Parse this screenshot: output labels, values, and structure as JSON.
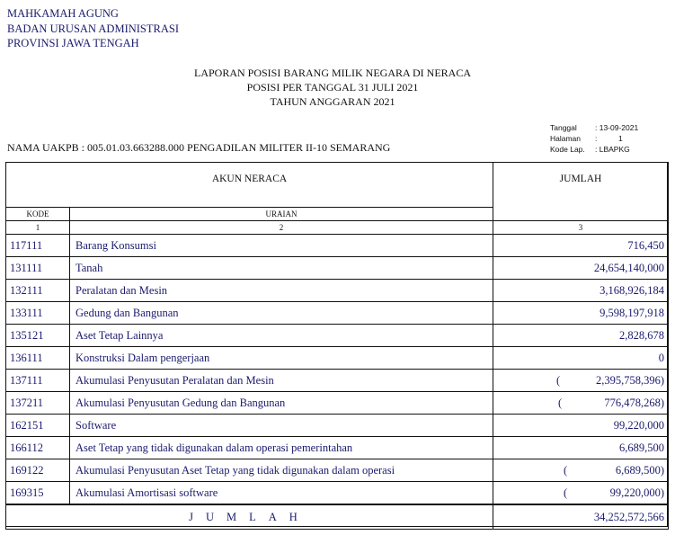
{
  "header": {
    "org_lines": [
      "MAHKAMAH AGUNG",
      "BADAN URUSAN ADMINISTRASI",
      "PROVINSI JAWA TENGAH"
    ],
    "title_lines": [
      "LAPORAN POSISI BARANG MILIK NEGARA DI NERACA",
      "POSISI PER TANGGAL 31 JULI 2021",
      "TAHUN ANGGARAN  2021"
    ],
    "meta": {
      "tanggal_label": "Tanggal",
      "tanggal_value": ": 13-09-2021",
      "halaman_label": "Halaman",
      "halaman_value": "1",
      "kode_label": "Kode Lap.",
      "kode_value": ": LBAPKG"
    },
    "uakpb": "NAMA UAKPB  :  005.01.03.663288.000   PENGADILAN MILITER II-10 SEMARANG"
  },
  "table": {
    "col_akun": "AKUN NERACA",
    "col_jumlah": "JUMLAH",
    "col_kode": "KODE",
    "col_uraian": "URAIAN",
    "num1": "1",
    "num2": "2",
    "num3": "3",
    "rows": [
      {
        "kode": "117111",
        "uraian": "Barang Konsumsi",
        "jumlah": "716,450"
      },
      {
        "kode": "131111",
        "uraian": "Tanah",
        "jumlah": "24,654,140,000"
      },
      {
        "kode": "132111",
        "uraian": "Peralatan dan Mesin",
        "jumlah": "3,168,926,184"
      },
      {
        "kode": "133111",
        "uraian": "Gedung dan Bangunan",
        "jumlah": "9,598,197,918"
      },
      {
        "kode": "135121",
        "uraian": "Aset Tetap Lainnya",
        "jumlah": "2,828,678"
      },
      {
        "kode": "136111",
        "uraian": "Konstruksi Dalam pengerjaan",
        "jumlah": "0"
      },
      {
        "kode": "137111",
        "uraian": "Akumulasi Penyusutan Peralatan dan Mesin",
        "paren_open": "(",
        "jumlah": "2,395,758,396)"
      },
      {
        "kode": "137211",
        "uraian": "Akumulasi Penyusutan Gedung dan Bangunan",
        "paren_open": "(",
        "jumlah": "776,478,268)"
      },
      {
        "kode": "162151",
        "uraian": "Software",
        "jumlah": "99,220,000"
      },
      {
        "kode": "166112",
        "uraian": "Aset Tetap yang tidak digunakan dalam operasi pemerintahan",
        "jumlah": "6,689,500"
      },
      {
        "kode": "169122",
        "uraian": "Akumulasi Penyusutan Aset Tetap yang tidak digunakan dalam operasi",
        "paren_open": "(",
        "jumlah": "6,689,500)"
      },
      {
        "kode": "169315",
        "uraian": "Akumulasi Amortisasi software",
        "paren_open": "(",
        "jumlah": "99,220,000)"
      }
    ],
    "total_label": "JUMLAH",
    "total_value": "34,252,572,566"
  }
}
